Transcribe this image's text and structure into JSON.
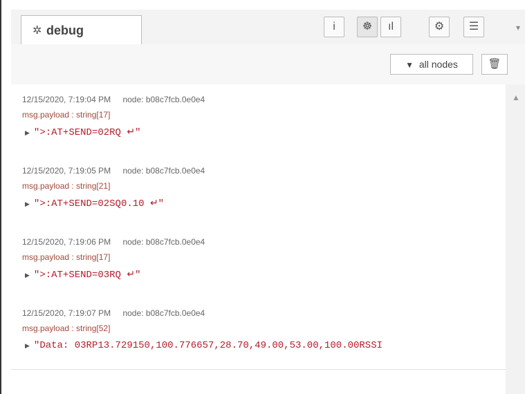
{
  "tabbar": {
    "tab_label": "debug",
    "tab_icon": "bug-icon",
    "buttons": [
      {
        "name": "info",
        "glyph": "i"
      },
      {
        "name": "debug",
        "glyph": "☸"
      },
      {
        "name": "dashboard",
        "glyph": "ıl"
      },
      {
        "name": "config",
        "glyph": "⚙"
      },
      {
        "name": "context",
        "glyph": "☰"
      }
    ],
    "dropdown_glyph": "▾"
  },
  "filter": {
    "label": "all nodes",
    "funnel_glyph": "▼",
    "trash_glyph": "🗑"
  },
  "messages": [
    {
      "timestamp": "12/15/2020, 7:19:04 PM",
      "node": "node: b08c7fcb.0e0e4",
      "type": "msg.payload : string[17]",
      "value": "\">:AT+SEND=02RQ ↵\""
    },
    {
      "timestamp": "12/15/2020, 7:19:05 PM",
      "node": "node: b08c7fcb.0e0e4",
      "type": "msg.payload : string[21]",
      "value": "\">:AT+SEND=02SQ0.10 ↵\""
    },
    {
      "timestamp": "12/15/2020, 7:19:06 PM",
      "node": "node: b08c7fcb.0e0e4",
      "type": "msg.payload : string[17]",
      "value": "\">:AT+SEND=03RQ ↵\""
    },
    {
      "timestamp": "12/15/2020, 7:19:07 PM",
      "node": "node: b08c7fcb.0e0e4",
      "type": "msg.payload : string[52]",
      "value": "\"Data: 03RP13.729150,100.776657,28.70,49.00,53.00,100.00RSSI"
    }
  ],
  "scroll_up_glyph": "▲"
}
